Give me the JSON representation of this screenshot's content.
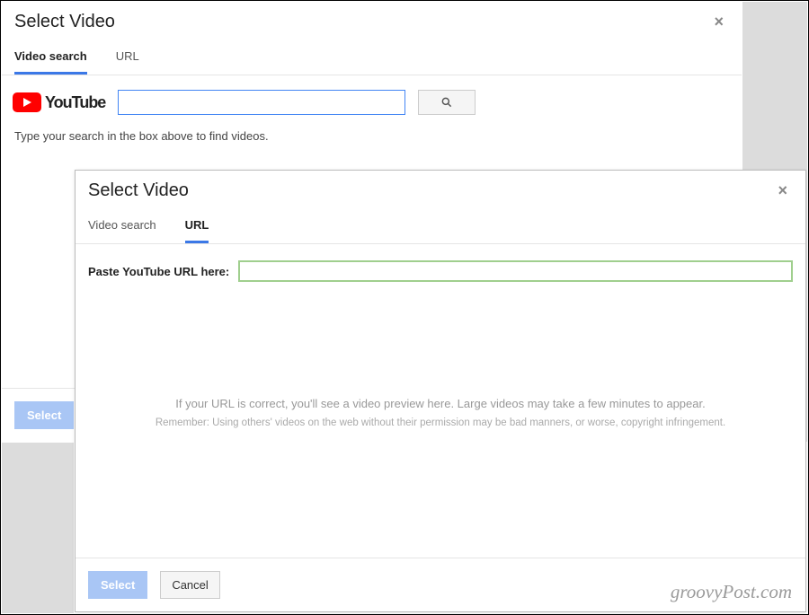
{
  "dialog1": {
    "title": "Select Video",
    "tabs": [
      {
        "label": "Video search",
        "active": true
      },
      {
        "label": "URL",
        "active": false
      }
    ],
    "logo_text": "YouTube",
    "search_value": "",
    "help_text": "Type your search in the box above to find videos.",
    "select_label": "Select"
  },
  "dialog2": {
    "title": "Select Video",
    "tabs": [
      {
        "label": "Video search",
        "active": false
      },
      {
        "label": "URL",
        "active": true
      }
    ],
    "url_label": "Paste YouTube URL here:",
    "url_value": "",
    "preview_line1": "If your URL is correct, you'll see a video preview here. Large videos may take a few minutes to appear.",
    "preview_line2": "Remember: Using others' videos on the web without their permission may be bad manners, or worse, copyright infringement.",
    "select_label": "Select",
    "cancel_label": "Cancel"
  },
  "watermark": "groovyPost.com"
}
